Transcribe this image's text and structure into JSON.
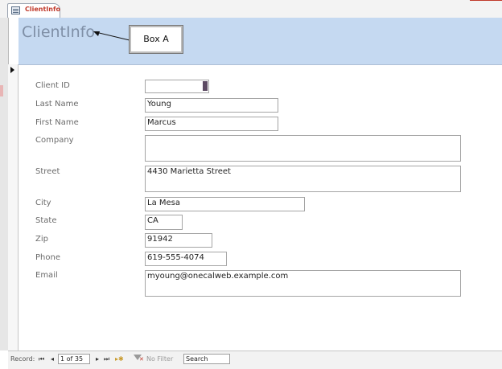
{
  "tab": {
    "label": "ClientInfo"
  },
  "header": {
    "title": "ClientInfo",
    "callout": "Box A"
  },
  "fields": [
    {
      "label": "Client ID",
      "value": ""
    },
    {
      "label": "Last Name",
      "value": "Young"
    },
    {
      "label": "First Name",
      "value": "Marcus"
    },
    {
      "label": "Company",
      "value": ""
    },
    {
      "label": "Street",
      "value": "4430 Marietta Street"
    },
    {
      "label": "City",
      "value": "La Mesa"
    },
    {
      "label": "State",
      "value": "CA"
    },
    {
      "label": "Zip",
      "value": "91942"
    },
    {
      "label": "Phone",
      "value": "619-555-4074"
    },
    {
      "label": "Email",
      "value": "myoung@onecalweb.example.com"
    }
  ],
  "navigation": {
    "record_label": "Record:",
    "position": "1 of 35",
    "first": "⏮",
    "prev": "◂",
    "next": "▸",
    "last": "⏭",
    "new": "▸✱",
    "filter": "No Filter",
    "search_placeholder": "Search"
  }
}
